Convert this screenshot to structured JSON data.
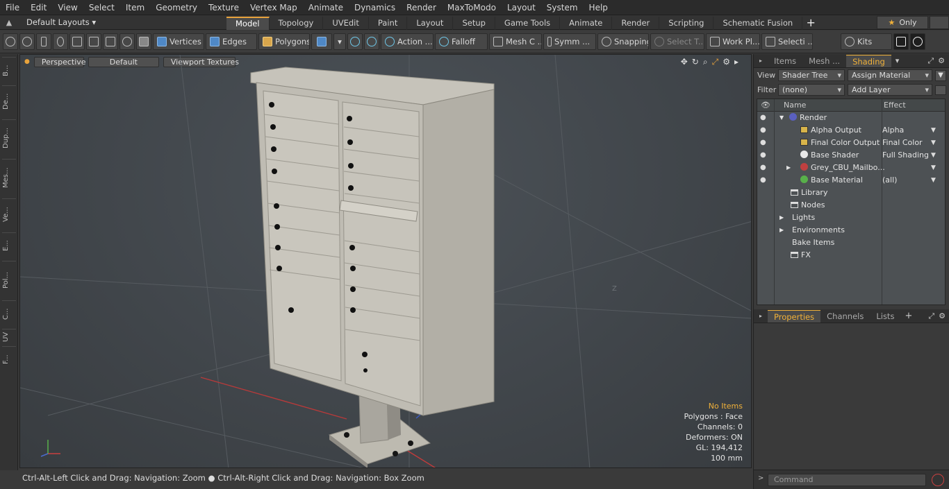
{
  "menu": [
    "File",
    "Edit",
    "View",
    "Select",
    "Item",
    "Geometry",
    "Texture",
    "Vertex Map",
    "Animate",
    "Dynamics",
    "Render",
    "MaxToModo",
    "Layout",
    "System",
    "Help"
  ],
  "layout": {
    "preset": "Default Layouts",
    "tabs": [
      "Model",
      "Topology",
      "UVEdit",
      "Paint",
      "Layout",
      "Setup",
      "Game Tools",
      "Animate",
      "Render",
      "Scripting",
      "Schematic Fusion"
    ],
    "add_tab": "+",
    "only_label": "Only"
  },
  "toolbar": {
    "vertices": "Vertices",
    "edges": "Edges",
    "polygons": "Polygons",
    "action": "Action ...",
    "falloff": "Falloff",
    "mesh": "Mesh C ...",
    "symm": "Symm ...",
    "snapping": "Snapping",
    "select_t": "Select T...",
    "work_pl": "Work Pl...",
    "selecti": "Selecti ...",
    "kits": "Kits"
  },
  "left_tabs": [
    "B...",
    "De...",
    "Dup...",
    "Mes...",
    "Ve...",
    "E...",
    "Pol...",
    "C...",
    "UV",
    "F..."
  ],
  "viewport": {
    "perspective": "Perspective",
    "shading": "Default",
    "textures": "Viewport Textures",
    "axis_z": "Z",
    "info": {
      "items": "No Items",
      "polygons": "Polygons : Face",
      "channels": "Channels: 0",
      "deformers": "Deformers: ON",
      "gl": "GL: 194,412",
      "unit": "100 mm"
    }
  },
  "status": {
    "hint1": "Ctrl-Alt-Left Click and Drag: Navigation: Zoom",
    "hint2": "Ctrl-Alt-Right Click and Drag: Navigation: Box Zoom"
  },
  "right_panel": {
    "tabs": [
      "Items",
      "Mesh ...",
      "Shading"
    ],
    "view_label": "View",
    "view_value": "Shader Tree",
    "assign_material": "Assign Material",
    "filter_label": "Filter",
    "filter_value": "(none)",
    "add_layer": "Add Layer",
    "col_name": "Name",
    "col_effect": "Effect",
    "tree": [
      {
        "name": "Render",
        "effect": "",
        "indent": 0,
        "icon": "render"
      },
      {
        "name": "Alpha Output",
        "effect": "Alpha",
        "indent": 1,
        "icon": "layer"
      },
      {
        "name": "Final Color Output",
        "effect": "Final Color",
        "indent": 1,
        "icon": "layer"
      },
      {
        "name": "Base Shader",
        "effect": "Full Shading",
        "indent": 1,
        "icon": "shader"
      },
      {
        "name": "Grey_CBU_Mailbo...",
        "effect": "",
        "indent": 1,
        "icon": "mask"
      },
      {
        "name": "Base Material",
        "effect": "(all)",
        "indent": 1,
        "icon": "material"
      },
      {
        "name": "Library",
        "effect": "",
        "indent": 2,
        "icon": "folder"
      },
      {
        "name": "Nodes",
        "effect": "",
        "indent": 2,
        "icon": "folder"
      },
      {
        "name": "Lights",
        "effect": "",
        "indent": 3,
        "icon": "none"
      },
      {
        "name": "Environments",
        "effect": "",
        "indent": 3,
        "icon": "none"
      },
      {
        "name": "Bake Items",
        "effect": "",
        "indent": 3,
        "icon": "none"
      },
      {
        "name": "FX",
        "effect": "",
        "indent": 2,
        "icon": "fx"
      }
    ],
    "props_tabs": [
      "Properties",
      "Channels",
      "Lists"
    ],
    "props_add": "+",
    "command_placeholder": "Command"
  },
  "colors": {
    "accent": "#f0b13a",
    "panel": "#3a3a3a"
  }
}
